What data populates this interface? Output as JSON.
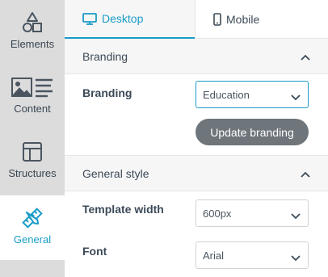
{
  "sidebar": {
    "items": [
      {
        "label": "Elements",
        "icon": "elements-shapes-icon"
      },
      {
        "label": "Content",
        "icon": "content-image-text-icon"
      },
      {
        "label": "Structures",
        "icon": "structures-layout-icon"
      },
      {
        "label": "General",
        "icon": "general-brush-ruler-icon",
        "active": true
      }
    ]
  },
  "tabs": {
    "desktop_label": "Desktop",
    "mobile_label": "Mobile"
  },
  "branding_section": {
    "title": "Branding",
    "field_label": "Branding",
    "select_value": "Education",
    "button_label": "Update branding"
  },
  "general_style_section": {
    "title": "General style",
    "template_width_label": "Template width",
    "template_width_value": "600px",
    "font_label": "Font",
    "font_value": "Arial"
  },
  "colors": {
    "accent": "#1a9cc7",
    "sidebar_bg": "#dcdcdc",
    "section_bg": "#f6f6f6",
    "button_bg": "#6e757b"
  }
}
